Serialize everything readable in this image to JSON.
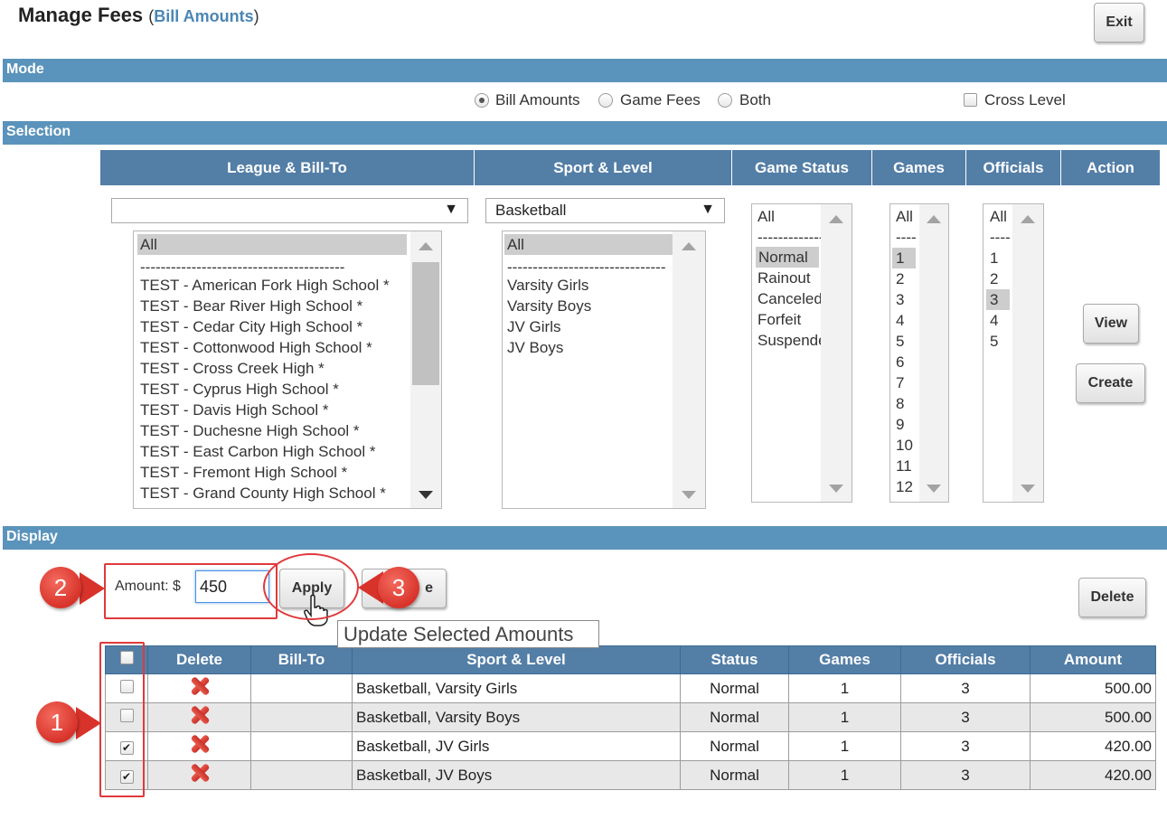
{
  "header": {
    "title": "Manage Fees",
    "sub_open": "(",
    "sub_mode": "Bill Amounts",
    "sub_close": ")",
    "exit_label": "Exit"
  },
  "mode": {
    "section_label": "Mode",
    "options": [
      "Bill Amounts",
      "Game Fees",
      "Both"
    ],
    "selected": "Bill Amounts",
    "cross_level_label": "Cross Level",
    "cross_level_checked": false
  },
  "selection": {
    "section_label": "Selection",
    "columns": [
      "League & Bill-To",
      "Sport & Level",
      "Game Status",
      "Games",
      "Officials",
      "Action"
    ],
    "league_combo_value": "",
    "league_list": [
      "All",
      "----------------------------------------",
      "TEST - American Fork High School *",
      "TEST - Bear River High School *",
      "TEST - Cedar City High School *",
      "TEST - Cottonwood High School *",
      "TEST - Cross Creek High *",
      "TEST - Cyprus High School *",
      "TEST - Davis High School *",
      "TEST - Duchesne High School *",
      "TEST - East Carbon High School *",
      "TEST - Fremont High School *",
      "TEST - Grand County High School *"
    ],
    "sport_combo_value": "Basketball",
    "sport_list": [
      "All",
      "-------------------------------",
      "Varsity Girls",
      "Varsity Boys",
      "JV Girls",
      "JV Boys"
    ],
    "status_list": [
      "All",
      "--------------",
      "Normal",
      "Rainout",
      "Canceled",
      "Forfeit",
      "Suspended"
    ],
    "games_list": [
      "All",
      "----",
      "1",
      "2",
      "3",
      "4",
      "5",
      "6",
      "7",
      "8",
      "9",
      "10",
      "11",
      "12"
    ],
    "officials_list": [
      "All",
      "----",
      "1",
      "2",
      "3",
      "4",
      "5"
    ],
    "view_label": "View",
    "create_label": "Create"
  },
  "display": {
    "section_label": "Display",
    "amount_label": "Amount: $",
    "amount_value": "450",
    "apply_label": "Apply",
    "hidden_button_label": "e",
    "delete_label": "Delete",
    "tooltip": "Update Selected Amounts",
    "columns": [
      "Delete",
      "Bill-To",
      "Sport & Level",
      "Status",
      "Games",
      "Officials",
      "Amount"
    ],
    "rows": [
      {
        "checked": false,
        "bill_to": "",
        "sport_level": "Basketball, Varsity Girls",
        "status": "Normal",
        "games": "1",
        "officials": "3",
        "amount": "500.00"
      },
      {
        "checked": false,
        "bill_to": "",
        "sport_level": "Basketball, Varsity Boys",
        "status": "Normal",
        "games": "1",
        "officials": "3",
        "amount": "500.00"
      },
      {
        "checked": true,
        "bill_to": "",
        "sport_level": "Basketball, JV Girls",
        "status": "Normal",
        "games": "1",
        "officials": "3",
        "amount": "420.00"
      },
      {
        "checked": true,
        "bill_to": "",
        "sport_level": "Basketball, JV Boys",
        "status": "Normal",
        "games": "1",
        "officials": "3",
        "amount": "420.00"
      }
    ]
  },
  "callouts": [
    "1",
    "2",
    "3"
  ],
  "colors": {
    "section_bar": "#5a93bb",
    "table_header": "#537ea6",
    "callout": "#d8332a"
  }
}
